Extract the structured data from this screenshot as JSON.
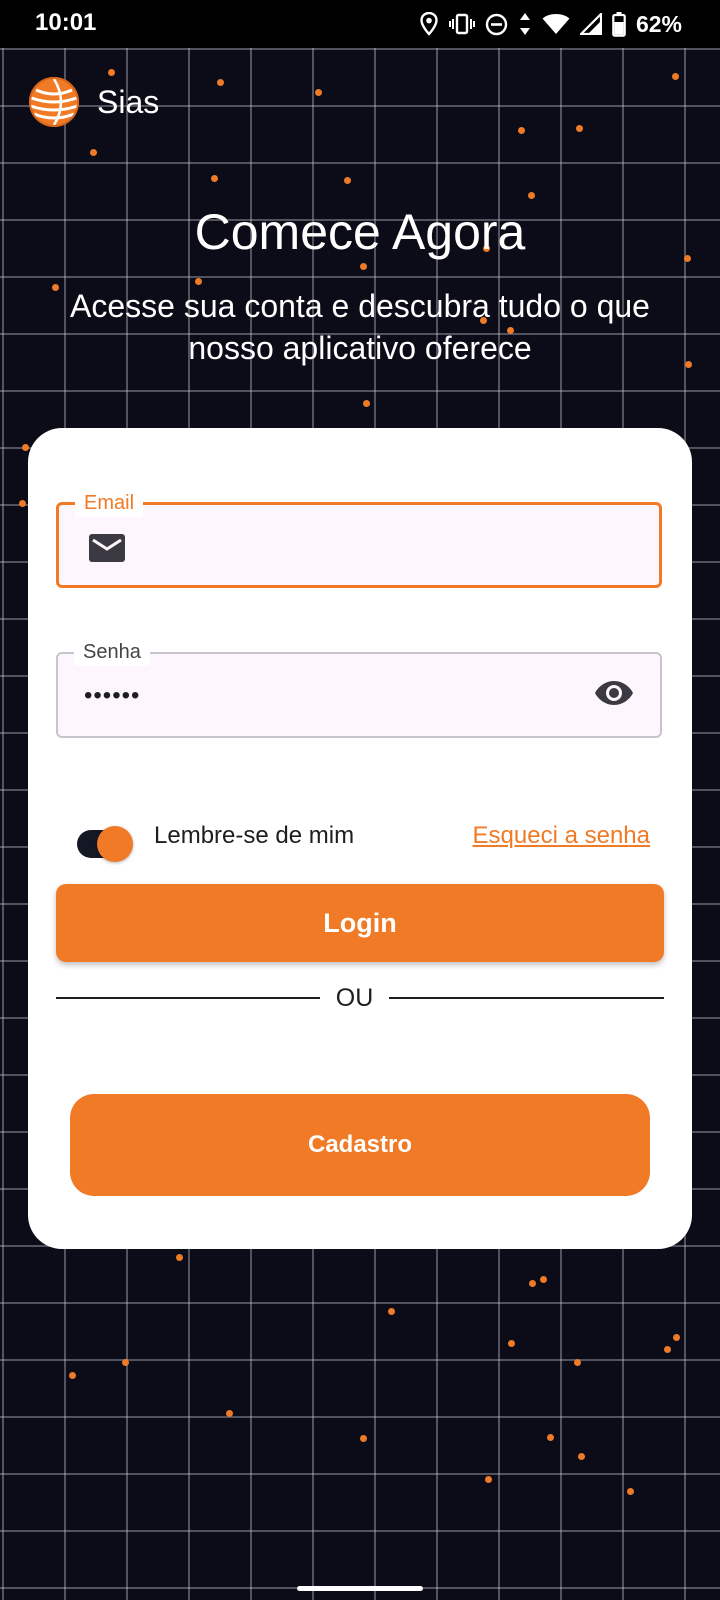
{
  "status_bar": {
    "time": "10:01",
    "battery": "62%",
    "icons": [
      "location-icon",
      "vibrate-icon",
      "dnd-icon",
      "data-arrows-icon",
      "wifi-icon",
      "signal-icon",
      "battery-icon"
    ]
  },
  "app": {
    "name": "Sias",
    "logo_icon": "orange-globe-logo"
  },
  "hero": {
    "title": "Comece Agora",
    "subtitle": "Acesse sua conta e descubra tudo o que nosso aplicativo oferece"
  },
  "form": {
    "email": {
      "label": "Email",
      "value": "",
      "icon": "mail-icon"
    },
    "password": {
      "label": "Senha",
      "value": "••••••",
      "icon": "eye-icon"
    },
    "remember": {
      "label": "Lembre-se de mim",
      "checked": true
    },
    "forgot_label": "Esqueci a senha",
    "login_label": "Login",
    "divider_label": "OU",
    "signup_label": "Cadastro"
  },
  "colors": {
    "accent": "#f07a26",
    "background": "#0c0c18",
    "card": "#ffffff",
    "field_fill": "#fdf7fd"
  }
}
